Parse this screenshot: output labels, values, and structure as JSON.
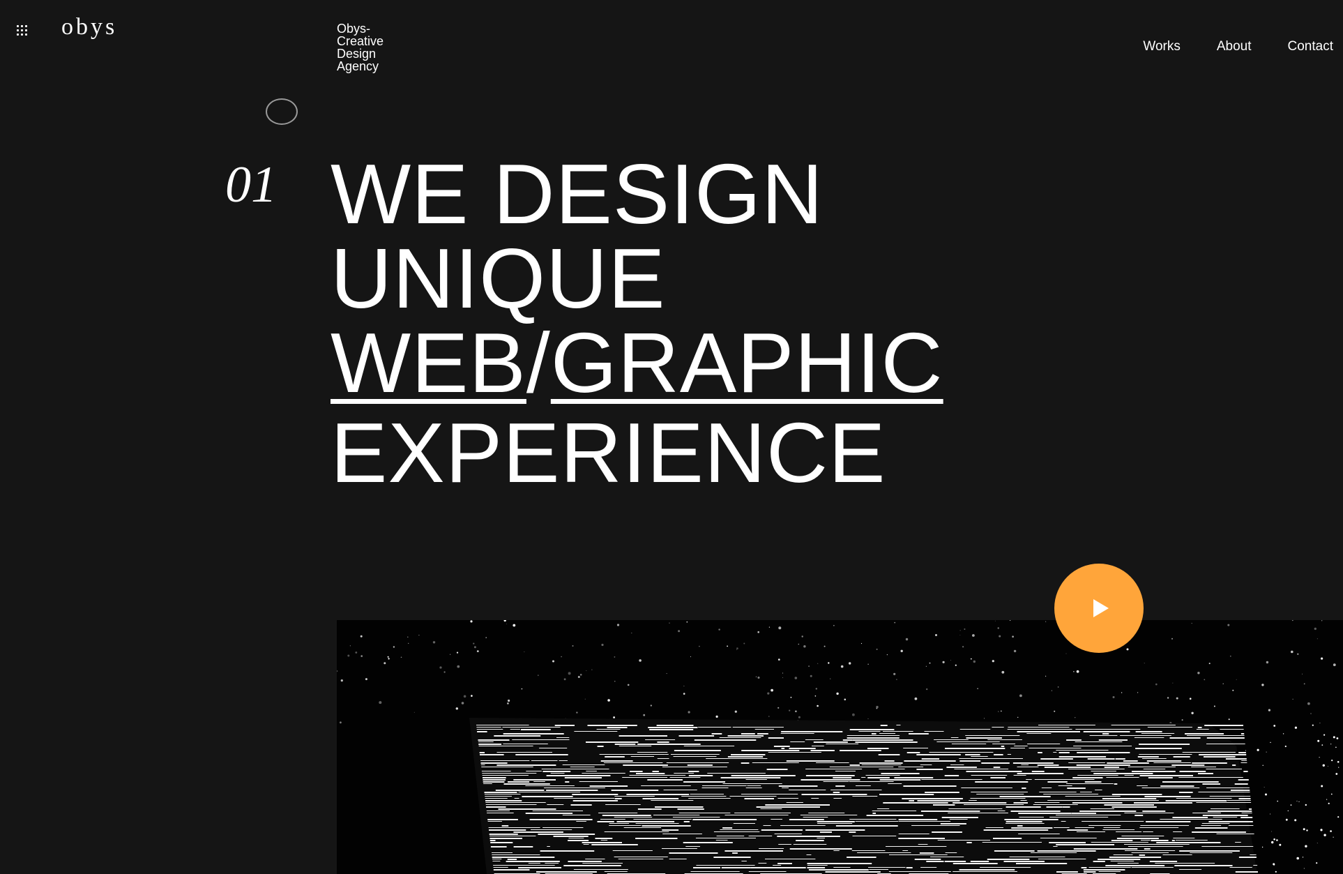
{
  "header": {
    "logo": "obys",
    "tagline_lines": [
      "Obys-",
      "Creative",
      "Design",
      "Agency"
    ],
    "menu_icon": "grid-menu-icon",
    "nav": [
      {
        "label": "Works"
      },
      {
        "label": "About"
      },
      {
        "label": "Contact"
      }
    ]
  },
  "hero": {
    "number": "01",
    "headline": {
      "line1": "WE DESIGN",
      "line2": "UNIQUE",
      "line3_part1": "WEB",
      "line3_slash": "/",
      "line3_part2": "GRAPHIC",
      "line4": "EXPERIENCE"
    }
  },
  "media": {
    "play_icon": "play-icon",
    "accent_color": "#ffa53a"
  }
}
